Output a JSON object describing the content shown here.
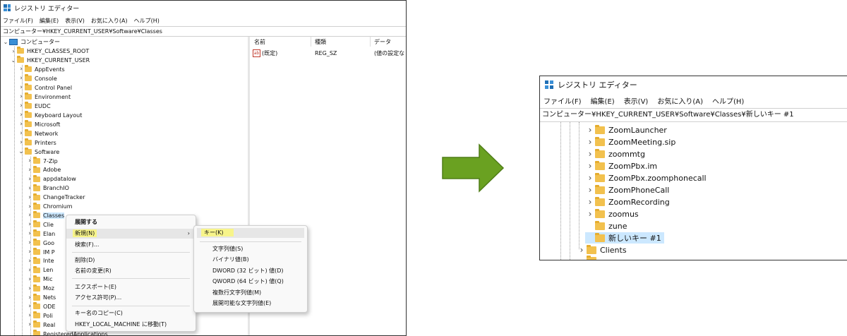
{
  "left": {
    "title": "レジストリ エディター",
    "menu": [
      "ファイル(F)",
      "編集(E)",
      "表示(V)",
      "お気に入り(A)",
      "ヘルプ(H)"
    ],
    "address": "コンピューター¥HKEY_CURRENT_USER¥Software¥Classes",
    "tree": {
      "root": "コンピューター",
      "hkcr": "HKEY_CLASSES_ROOT",
      "hkcu": "HKEY_CURRENT_USER",
      "hkcu_children": [
        "AppEvents",
        "Console",
        "Control Panel",
        "Environment",
        "EUDC",
        "Keyboard Layout",
        "Microsoft",
        "Network",
        "Printers",
        "Software"
      ],
      "software_children": [
        "7-Zip",
        "Adobe",
        "appdatalow",
        "BranchIO",
        "ChangeTracker",
        "Chromium",
        "Classes",
        "Clie",
        "Elan",
        "Goo",
        "IM P",
        "Inte",
        "Len",
        "Mic",
        "Moz",
        "Nets",
        "ODE",
        "Poli",
        "Real",
        "RegisteredApplications"
      ]
    },
    "values_header": {
      "name": "名前",
      "type": "種類",
      "data": "データ"
    },
    "values_row": {
      "name": "(既定)",
      "type": "REG_SZ",
      "data": "(値の設定な",
      "icon": "ab-icon"
    },
    "context_menu": {
      "items": [
        "展開する",
        "新規(N)",
        "検索(F)...",
        "削除(D)",
        "名前の変更(R)",
        "エクスポート(E)",
        "アクセス許可(P)...",
        "キー名のコピー(C)",
        "HKEY_LOCAL_MACHINE に移動(T)"
      ],
      "highlight_color": "#f7f48a"
    },
    "submenu": {
      "items": [
        "キー(K)",
        "文字列値(S)",
        "バイナリ値(B)",
        "DWORD (32 ビット) 値(D)",
        "QWORD (64 ビット) 値(Q)",
        "複数行文字列値(M)",
        "展開可能な文字列値(E)"
      ]
    }
  },
  "arrow": {
    "color": "#6aa121",
    "icon": "right-arrow-icon"
  },
  "right": {
    "title": "レジストリ エディター",
    "menu": [
      "ファイル(F)",
      "編集(E)",
      "表示(V)",
      "お気に入り(A)",
      "ヘルプ(H)"
    ],
    "address": "コンピューター¥HKEY_CURRENT_USER¥Software¥Classes¥新しいキー #1",
    "tree_items": [
      "ZoomLauncher",
      "ZoomMeeting.sip",
      "zoommtg",
      "ZoomPbx.im",
      "ZoomPbx.zoomphonecall",
      "ZoomPhoneCall",
      "ZoomRecording",
      "zoomus",
      "zune",
      "新しいキー #1"
    ],
    "clients": "Clients",
    "selected_color": "#cce8ff"
  }
}
